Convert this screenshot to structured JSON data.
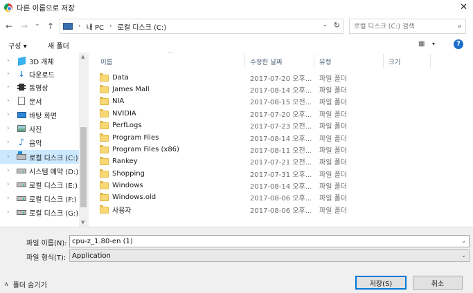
{
  "window": {
    "title": "다른 이름으로 저장",
    "close_glyph": "✕"
  },
  "nav": {
    "back": "←",
    "forward": "→",
    "history": "⌄",
    "up": "↑"
  },
  "address": {
    "crumbs": [
      "내 PC",
      "로컬 디스크 (C:)"
    ],
    "separator": "›",
    "dropdown": "⌄",
    "refresh": "↻"
  },
  "search": {
    "placeholder": "로컬 디스크 (C:) 검색",
    "icon": "⌕"
  },
  "toolbar": {
    "organize": "구성 ▾",
    "new_folder": "새 폴더",
    "view_glyph": "▦",
    "view_dd": "▾",
    "help": "?"
  },
  "sidebar": {
    "items": [
      {
        "label": "3D 개체",
        "icon": "cube-icon"
      },
      {
        "label": "다운로드",
        "icon": "download-icon"
      },
      {
        "label": "동영상",
        "icon": "video-icon"
      },
      {
        "label": "문서",
        "icon": "document-icon"
      },
      {
        "label": "바탕 화면",
        "icon": "desktop-icon"
      },
      {
        "label": "사진",
        "icon": "pictures-icon"
      },
      {
        "label": "음악",
        "icon": "music-icon"
      },
      {
        "label": "로컬 디스크 (C:)",
        "icon": "system-drive-icon",
        "selected": true
      },
      {
        "label": "시스템 예약 (D:)",
        "icon": "drive-icon"
      },
      {
        "label": "로컬 디스크 (E:)",
        "icon": "drive-icon"
      },
      {
        "label": "로컬 디스크 (F:)",
        "icon": "drive-icon"
      },
      {
        "label": "로컬 디스크 (G:)",
        "icon": "drive-icon"
      }
    ]
  },
  "columns": {
    "name": "이름",
    "date": "수정한 날짜",
    "type": "유형",
    "size": "크기"
  },
  "files": [
    {
      "name": "Data",
      "date": "2017-07-20 오후...",
      "type": "파일 폴더"
    },
    {
      "name": "James Mall",
      "date": "2017-08-14 오후...",
      "type": "파일 폴더"
    },
    {
      "name": "NIA",
      "date": "2017-08-15 오전...",
      "type": "파일 폴더"
    },
    {
      "name": "NVIDIA",
      "date": "2017-07-20 오후...",
      "type": "파일 폴더"
    },
    {
      "name": "PerfLogs",
      "date": "2017-07-23 오전...",
      "type": "파일 폴더"
    },
    {
      "name": "Program Files",
      "date": "2017-08-14 오후...",
      "type": "파일 폴더"
    },
    {
      "name": "Program Files (x86)",
      "date": "2017-08-11 오전...",
      "type": "파일 폴더"
    },
    {
      "name": "Rankey",
      "date": "2017-07-21 오전...",
      "type": "파일 폴더"
    },
    {
      "name": "Shopping",
      "date": "2017-07-31 오후...",
      "type": "파일 폴더"
    },
    {
      "name": "Windows",
      "date": "2017-08-14 오후...",
      "type": "파일 폴더"
    },
    {
      "name": "Windows.old",
      "date": "2017-08-06 오후...",
      "type": "파일 폴더"
    },
    {
      "name": "사용자",
      "date": "2017-08-06 오후...",
      "type": "파일 폴더"
    }
  ],
  "form": {
    "filename_label": "파일 이름(N):",
    "filename_value": "cpu-z_1.80-en (1)",
    "filetype_label": "파일 형식(T):",
    "filetype_value": "Application",
    "dropdown": "⌄"
  },
  "footer": {
    "hide_folders": "폴더 숨기기",
    "save": "저장(S)",
    "cancel": "취소"
  }
}
